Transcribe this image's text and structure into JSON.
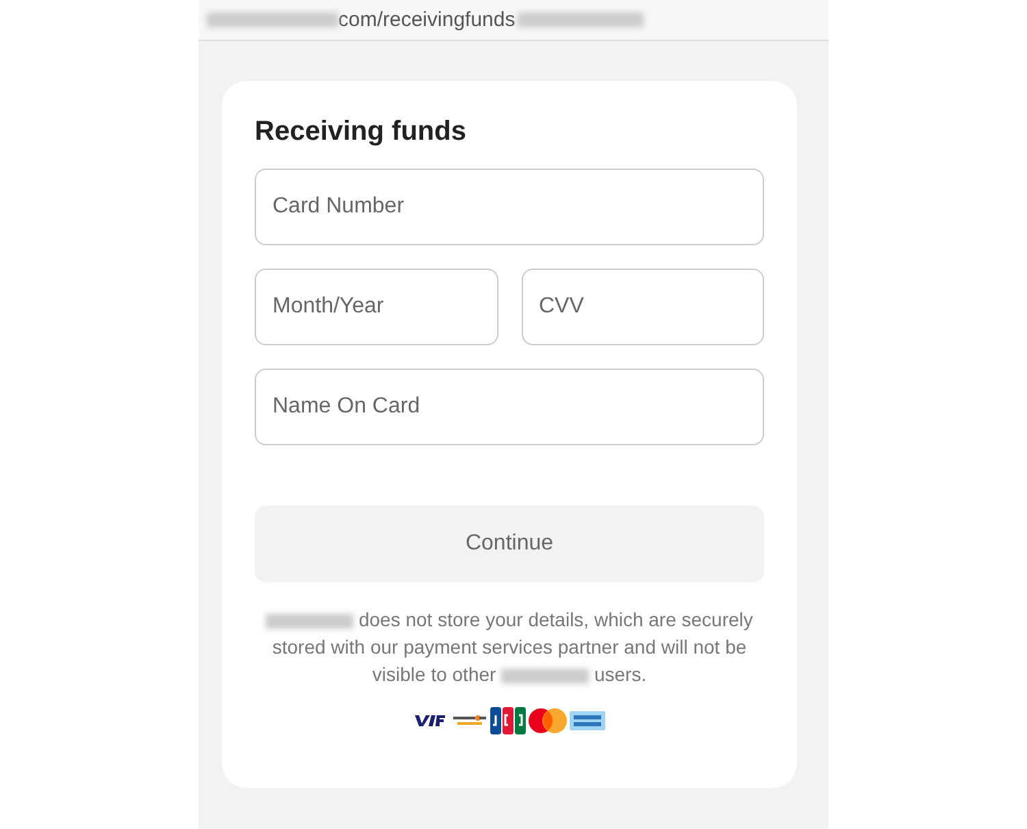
{
  "address_bar": {
    "url_visible": "com/receivingfunds"
  },
  "form": {
    "title": "Receiving funds",
    "field_rows": [
      [
        {
          "placeholder": "Card Number"
        }
      ],
      [
        {
          "placeholder": "Month/Year"
        },
        {
          "placeholder": "CVV"
        }
      ],
      [
        {
          "placeholder": "Name On Card"
        }
      ]
    ],
    "button": {
      "label": "Continue",
      "disabled": true
    },
    "notice": {
      "text_1": "does not store your details, which are securely stored with our payment services partner and will not be visible to other",
      "text_2": "users."
    },
    "card_logos": [
      {
        "kind": "visa"
      },
      {
        "kind": "discover"
      },
      {
        "kind": "jcb"
      },
      {
        "kind": "mastercard"
      },
      {
        "kind": "amex"
      }
    ]
  }
}
